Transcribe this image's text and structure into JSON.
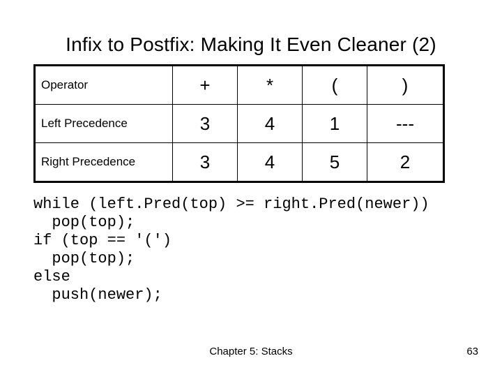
{
  "title": "Infix to Postfix: Making It Even Cleaner (2)",
  "table": {
    "rows": [
      {
        "label": "Operator",
        "cells": [
          "+",
          "*",
          "(",
          ")"
        ]
      },
      {
        "label": "Left Precedence",
        "cells": [
          "3",
          "4",
          "1",
          "---"
        ]
      },
      {
        "label": "Right Precedence",
        "cells": [
          "3",
          "4",
          "5",
          "2"
        ]
      }
    ]
  },
  "code": "while (left.Pred(top) >= right.Pred(newer))\n  pop(top);\nif (top == '(')\n  pop(top);\nelse\n  push(newer);",
  "footer": {
    "center": "Chapter 5: Stacks",
    "page": "63"
  }
}
